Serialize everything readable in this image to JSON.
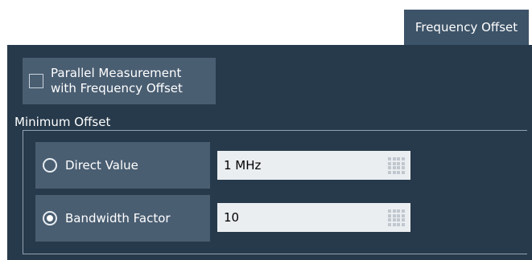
{
  "tab": {
    "label": "Frequency Offset"
  },
  "parallel_measurement": {
    "label": "Parallel Measurement\nwith Frequency Offset",
    "checked": false
  },
  "minimum_offset": {
    "title": "Minimum Offset",
    "options": [
      {
        "label": "Direct Value",
        "selected": false,
        "value": "1 MHz"
      },
      {
        "label": "Bandwidth Factor",
        "selected": true,
        "value": "10"
      }
    ]
  },
  "colors": {
    "panel": "#273a4b",
    "tab": "#3d5368",
    "control": "#4a5e72",
    "field": "#ebeef1"
  },
  "icons": {
    "field_button": "keypad-icon"
  }
}
